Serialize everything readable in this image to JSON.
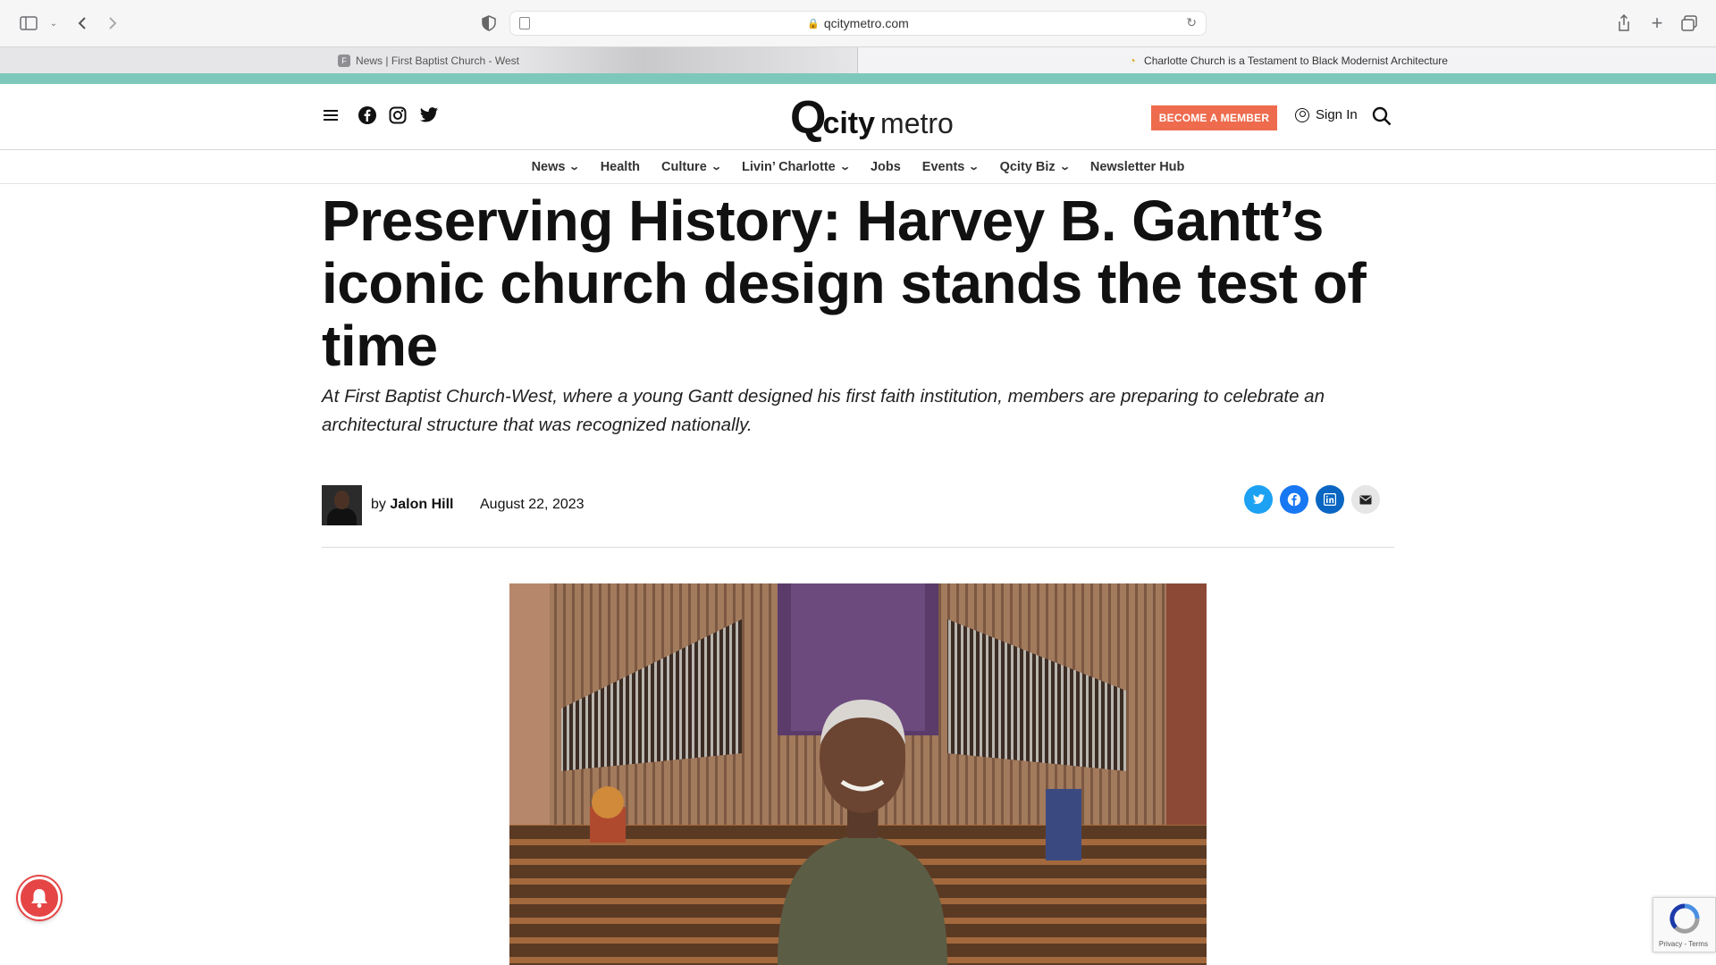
{
  "browser": {
    "url": "qcitymetro.com",
    "tabs": [
      {
        "label": "News | First Baptist Church - West",
        "favicon": "F"
      },
      {
        "label": "Charlotte Church is a Testament to Black Modernist Architecture"
      }
    ]
  },
  "site": {
    "logo_q": "Q",
    "logo_city": "city",
    "logo_metro": "metro",
    "member_button": "BECOME A MEMBER",
    "sign_in": "Sign In",
    "social_icons": [
      "facebook-icon",
      "instagram-icon",
      "twitter-icon"
    ],
    "accent_color": "#ee6b4d",
    "band_color": "#7ec8bb"
  },
  "nav": {
    "items": [
      {
        "label": "News",
        "dropdown": true
      },
      {
        "label": "Health",
        "dropdown": false
      },
      {
        "label": "Culture",
        "dropdown": true
      },
      {
        "label": "Livin’ Charlotte",
        "dropdown": true
      },
      {
        "label": "Jobs",
        "dropdown": false
      },
      {
        "label": "Events",
        "dropdown": true
      },
      {
        "label": "Qcity Biz",
        "dropdown": true
      },
      {
        "label": "Newsletter Hub",
        "dropdown": false
      }
    ]
  },
  "article": {
    "headline": "Preserving History: Harvey B. Gantt’s iconic church design stands the test of time",
    "dek": "At First Baptist Church-West, where a young Gantt designed his first faith institution, members are preparing to celebrate an architectural structure that was recognized nationally.",
    "by_prefix": "by",
    "author": "Jalon Hill",
    "date": "August 22, 2023",
    "share_icons": [
      {
        "name": "twitter-share-icon",
        "color": "#1da1f2"
      },
      {
        "name": "facebook-share-icon",
        "color": "#1877f2"
      },
      {
        "name": "linkedin-share-icon",
        "color": "#0a66c2"
      },
      {
        "name": "email-share-icon",
        "color": "#e6e6e6"
      }
    ]
  },
  "recaptcha": {
    "text": "Privacy - Terms"
  }
}
